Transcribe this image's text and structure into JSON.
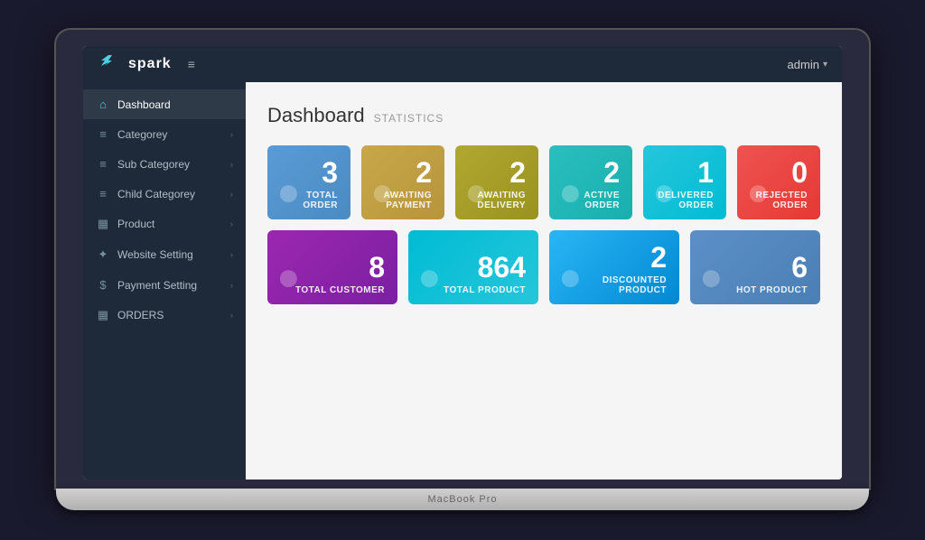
{
  "laptop": {
    "base_label": "MacBook Pro"
  },
  "topbar": {
    "logo_text": "spark",
    "user_label": "admin",
    "chevron": "▾",
    "hamburger": "≡"
  },
  "sidebar": {
    "items": [
      {
        "id": "dashboard",
        "icon": "⌂",
        "label": "Dashboard",
        "active": true,
        "chevron": ""
      },
      {
        "id": "category",
        "icon": "≡",
        "label": "Categorey",
        "active": false,
        "chevron": "›"
      },
      {
        "id": "sub-category",
        "icon": "≡",
        "label": "Sub Categorey",
        "active": false,
        "chevron": "›"
      },
      {
        "id": "child-category",
        "icon": "≡",
        "label": "Child Categorey",
        "active": false,
        "chevron": "›"
      },
      {
        "id": "product",
        "icon": "▦",
        "label": "Product",
        "active": false,
        "chevron": "›"
      },
      {
        "id": "website-setting",
        "icon": "✦",
        "label": "Website Setting",
        "active": false,
        "chevron": "›"
      },
      {
        "id": "payment-setting",
        "icon": "$",
        "label": "Payment Setting",
        "active": false,
        "chevron": "›"
      },
      {
        "id": "orders",
        "icon": "▦",
        "label": "ORDERS",
        "active": false,
        "chevron": "›"
      }
    ]
  },
  "content": {
    "page_title": "Dashboard",
    "page_subtitle": "Statistics",
    "row1": [
      {
        "id": "total-order",
        "number": "3",
        "label": "TOTAL ORDER",
        "color": "card-blue",
        "bg_icon": "●"
      },
      {
        "id": "awaiting-payment",
        "number": "2",
        "label": "Awaiting Payment",
        "color": "card-gold",
        "bg_icon": "●"
      },
      {
        "id": "awaiting-delivery",
        "number": "2",
        "label": "Awaiting Delivery",
        "color": "card-olive",
        "bg_icon": "●"
      },
      {
        "id": "active-order",
        "number": "2",
        "label": "ACTIVE ORDER",
        "color": "card-teal",
        "bg_icon": "●"
      },
      {
        "id": "delivered-order",
        "number": "1",
        "label": "DELIVERED ORDER",
        "color": "card-cyan",
        "bg_icon": "●"
      },
      {
        "id": "rejected-order",
        "number": "0",
        "label": "REJECTED ORDER",
        "color": "card-red",
        "bg_icon": "●"
      }
    ],
    "row2": [
      {
        "id": "total-customer",
        "number": "8",
        "label": "TOTAL CUSTOMER",
        "color": "card-purple",
        "bg_icon": "●"
      },
      {
        "id": "total-product",
        "number": "864",
        "label": "TOTAL PRODUCT",
        "color": "card-light-teal",
        "bg_icon": "●"
      },
      {
        "id": "discounted-product",
        "number": "2",
        "label": "DISCOUNTED PRODUCT",
        "color": "card-sky",
        "bg_icon": "●"
      },
      {
        "id": "hot-product",
        "number": "6",
        "label": "HOT PRODUCT",
        "color": "card-steel-blue",
        "bg_icon": "●"
      }
    ]
  }
}
